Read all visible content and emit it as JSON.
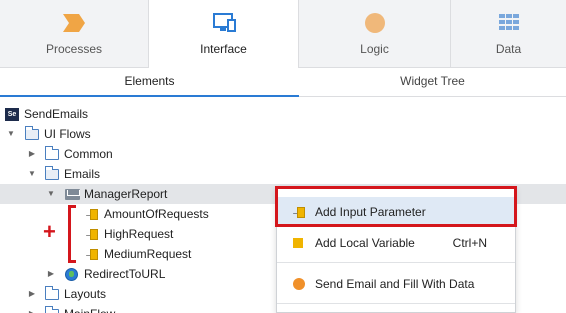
{
  "tabs": [
    {
      "label": "Processes",
      "icon": "process-chevron-icon"
    },
    {
      "label": "Interface",
      "icon": "monitor-icon"
    },
    {
      "label": "Logic",
      "icon": "circle-icon"
    },
    {
      "label": "Data",
      "icon": "grid-icon"
    }
  ],
  "subtabs": [
    {
      "label": "Elements"
    },
    {
      "label": "Widget Tree"
    }
  ],
  "tree": {
    "root": "SendEmails",
    "root_badge": "Se",
    "ui_flows": "UI Flows",
    "common": "Common",
    "emails": "Emails",
    "manager_report": "ManagerReport",
    "amount_of_requests": "AmountOfRequests",
    "high_request": "HighRequest",
    "medium_request": "MediumRequest",
    "redirect_to_url": "RedirectToURL",
    "layouts": "Layouts",
    "main_flow": "MainFlow"
  },
  "annotation": {
    "plus": "+"
  },
  "context_menu": {
    "add_input_parameter": "Add Input Parameter",
    "add_local_variable": "Add Local Variable",
    "add_local_variable_shortcut": "Ctrl+N",
    "send_email": "Send Email and Fill With Data"
  },
  "colors": {
    "accent": "#2a7bd4",
    "highlight_red": "#d4161c",
    "param_yellow": "#f0b400"
  }
}
